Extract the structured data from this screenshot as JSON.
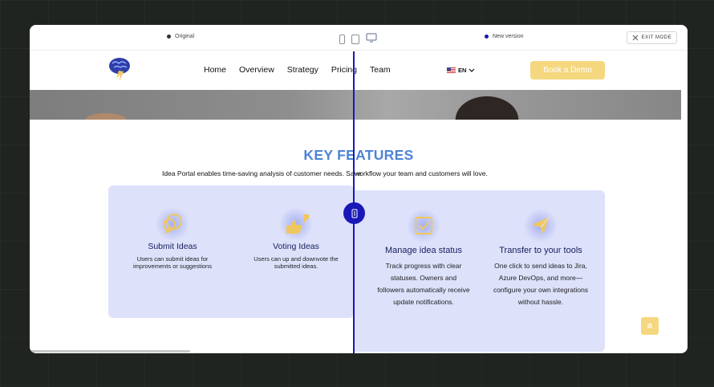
{
  "compare": {
    "original_label": "Original",
    "new_label": "New version",
    "exit_label": "EXIT MODE",
    "original_dot_color": "#333333",
    "new_dot_color": "#1a17b8",
    "devices": [
      "phone-icon",
      "tablet-icon",
      "desktop-icon"
    ]
  },
  "nav": {
    "items": [
      {
        "label": "Home"
      },
      {
        "label": "Overview"
      },
      {
        "label": "Strategy"
      },
      {
        "label": "Pricing"
      },
      {
        "label": "Team"
      }
    ],
    "language": "EN",
    "cta": "Book a Demo"
  },
  "features": {
    "heading": "KEY FEATURES",
    "subtitle_left": "Idea Portal enables time-saving analysis of customer needs. Save",
    "subtitle_right": "workflow your team and customers will love.",
    "cards": [
      {
        "title": "Submit Ideas",
        "desc": "Users can submit ideas for improvements or suggestions",
        "icon": "chat-bubble-icon"
      },
      {
        "title": "Voting Ideas",
        "desc": "Users can up and downvote the submitted ideas.",
        "icon": "thumbs-icon"
      },
      {
        "title": "Manage idea status",
        "desc": "Track progress with clear statuses. Owners and followers automatically receive update notifications.",
        "icon": "checkbox-icon"
      },
      {
        "title": "Transfer to your tools",
        "desc": "One click to send ideas to Jira, Azure DevOps, and more—configure your own integrations without hassle.",
        "icon": "paper-plane-icon"
      }
    ]
  },
  "colors": {
    "accent": "#1a17b8",
    "heading": "#4d84d6",
    "cta": "#f5d77f",
    "panel": "#dde1fa",
    "icon": "#f0c75e"
  }
}
